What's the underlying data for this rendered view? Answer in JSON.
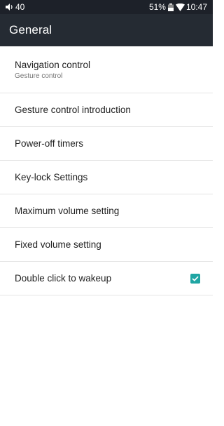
{
  "status_bar": {
    "volume_level": "40",
    "battery_percent": "51%",
    "time": "10:47",
    "icons": [
      "speaker-icon",
      "battery-icon",
      "wifi-icon"
    ]
  },
  "app_bar": {
    "title": "General"
  },
  "settings": {
    "items": [
      {
        "title": "Navigation control",
        "subtitle": "Gesture control"
      },
      {
        "title": "Gesture control introduction"
      },
      {
        "title": "Power-off timers"
      },
      {
        "title": "Key-lock Settings"
      },
      {
        "title": "Maximum volume setting"
      },
      {
        "title": "Fixed volume setting"
      },
      {
        "title": "Double click to wakeup",
        "checked": true
      }
    ]
  },
  "colors": {
    "status_bar_bg": "#1d2129",
    "app_bar_bg": "#252b33",
    "checkbox_accent": "#1fa5a3"
  }
}
